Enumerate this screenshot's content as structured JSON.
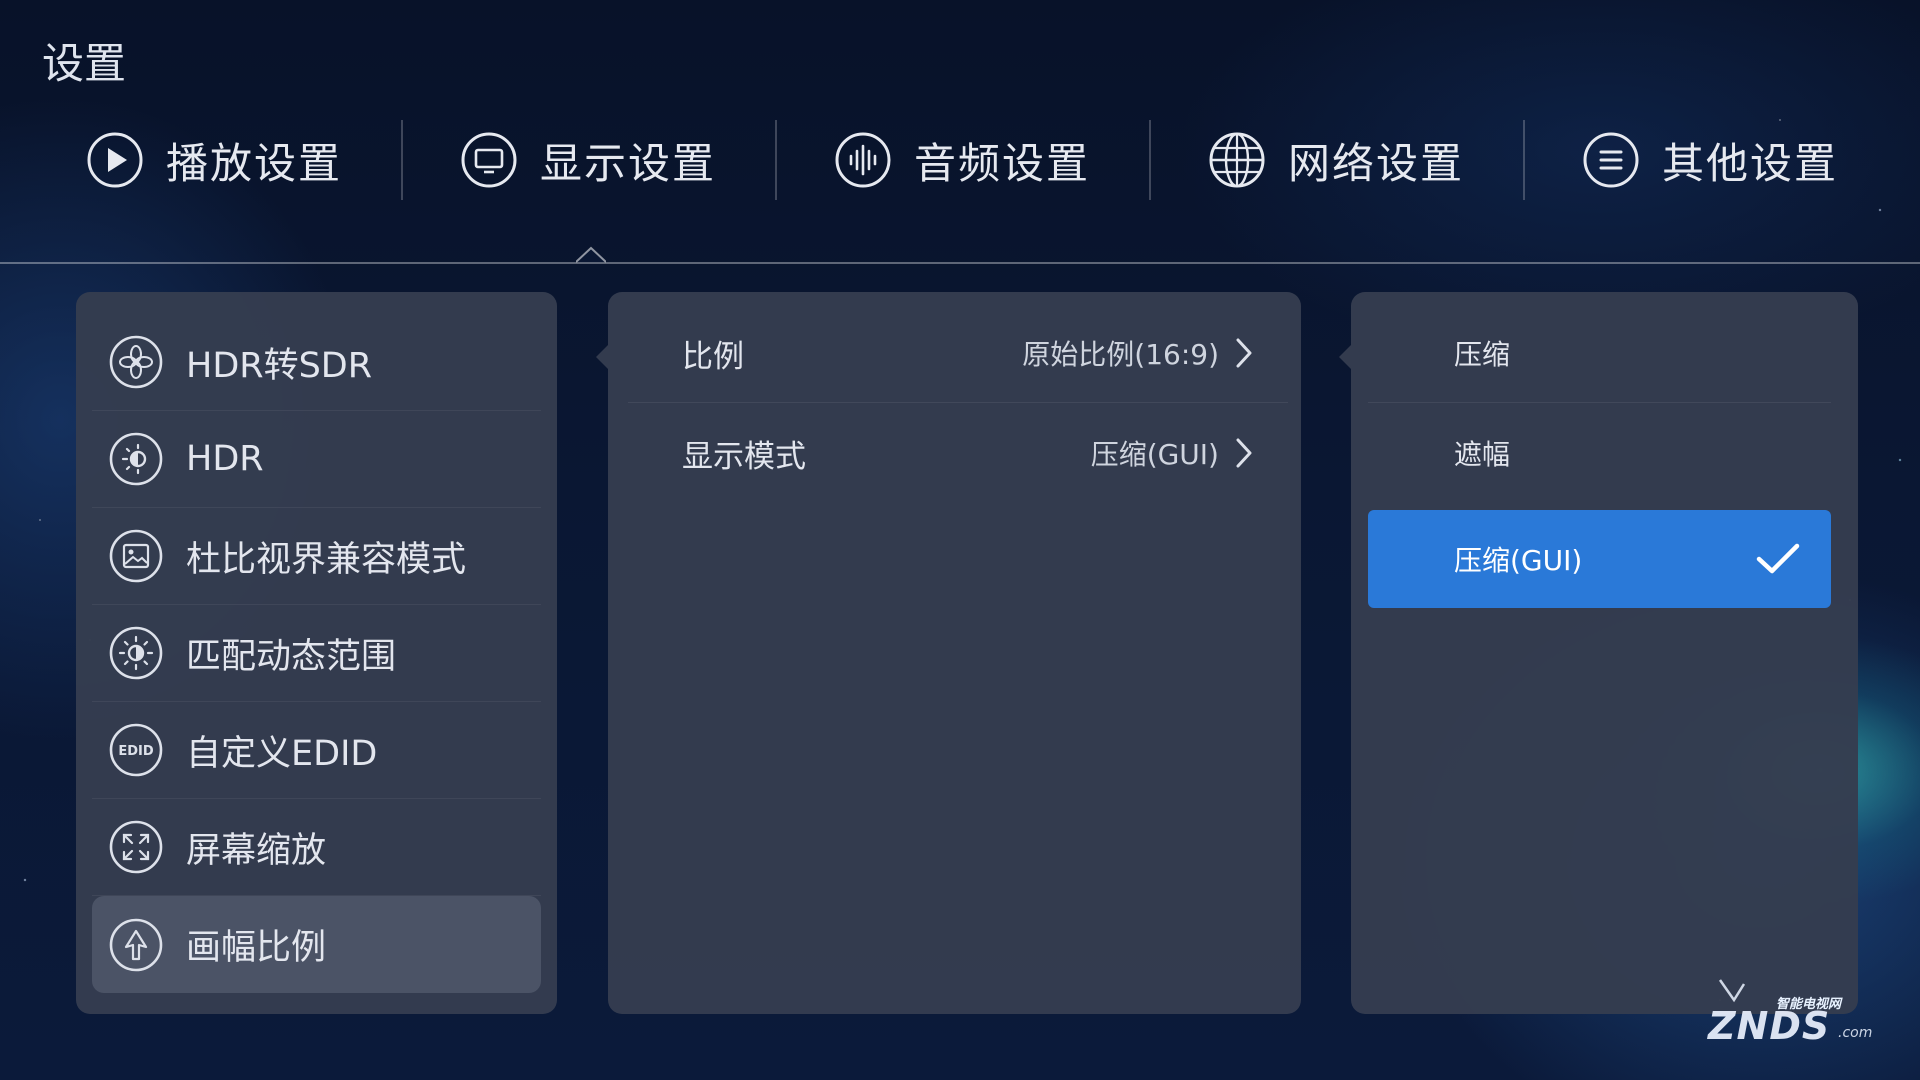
{
  "page": {
    "title": "设置"
  },
  "tabs": [
    {
      "label": "播放设置",
      "icon": "play-circle-icon"
    },
    {
      "label": "显示设置",
      "icon": "monitor-icon"
    },
    {
      "label": "音频设置",
      "icon": "audio-waveform-icon"
    },
    {
      "label": "网络设置",
      "icon": "globe-icon"
    },
    {
      "label": "其他设置",
      "icon": "menu-lines-icon"
    }
  ],
  "active_tab": "显示设置",
  "display_menu": [
    {
      "label": "HDR转SDR",
      "icon": "aperture-icon"
    },
    {
      "label": "HDR",
      "icon": "hdr-sun-icon"
    },
    {
      "label": "杜比视界兼容模式",
      "icon": "picture-icon"
    },
    {
      "label": "匹配动态范围",
      "icon": "brightness-icon"
    },
    {
      "label": "自定义EDID",
      "icon": "edid-icon",
      "icon_text": "EDID"
    },
    {
      "label": "屏幕缩放",
      "icon": "expand-arrows-icon"
    },
    {
      "label": "画幅比例",
      "icon": "aspect-ratio-icon",
      "selected": true
    }
  ],
  "aspect_settings": [
    {
      "label": "比例",
      "value": "原始比例(16:9)"
    },
    {
      "label": "显示模式",
      "value": "压缩(GUI)"
    }
  ],
  "display_mode_options": [
    {
      "label": "压缩",
      "selected": false
    },
    {
      "label": "遮幅",
      "selected": false
    },
    {
      "label": "压缩(GUI)",
      "selected": true
    }
  ],
  "colors": {
    "accent": "#2a79d8",
    "panel": "#353d50",
    "selected_item": "#4b5366"
  },
  "watermark": {
    "logo": "ZNDS",
    "subtitle": "智能电视网",
    "suffix": ".com"
  }
}
